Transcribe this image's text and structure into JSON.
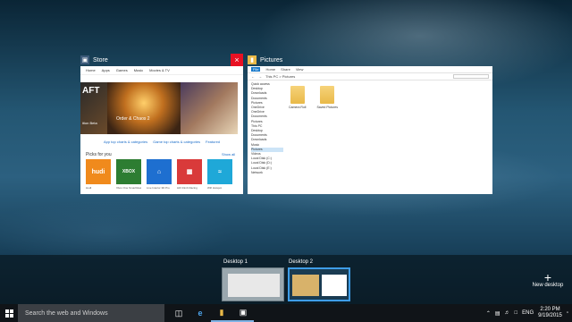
{
  "windows": [
    {
      "title": "Store",
      "nav": [
        "Home",
        "Apps",
        "Games",
        "Music",
        "Movies & TV"
      ],
      "hero_left_title": "AFT",
      "hero_left_sub": "ition Beta",
      "hero_main_title": "Order & Chaos 2",
      "links": [
        "App top charts & categories",
        "Game top charts & categories",
        "Featured"
      ],
      "picks_title": "Picks for you",
      "show_all": "Show all",
      "tiles": [
        {
          "label": "hudi",
          "color": "#f08a1c",
          "caption": "Hudl"
        },
        {
          "label": "XBOX",
          "color": "#2d7d32",
          "caption": "Xbox One SmartGlass"
        },
        {
          "label": "",
          "color": "#1e6fd0",
          "caption": "Live Interior 3D Pro"
        },
        {
          "label": "",
          "color": "#d93a3a",
          "caption": "Hill Climb Racing"
        },
        {
          "label": "",
          "color": "#1fa8d8",
          "caption": "Wifi Hotspot"
        }
      ]
    },
    {
      "title": "Pictures",
      "ribbon": [
        "File",
        "Home",
        "Share",
        "View"
      ],
      "address": "This PC > Pictures",
      "nav_items": [
        "Quick access",
        "Desktop",
        "Downloads",
        "Documents",
        "Pictures",
        "OneDrive",
        "OneDrive",
        "Documents",
        "Pictures",
        "This PC",
        "Desktop",
        "Documents",
        "Downloads",
        "Music",
        "Pictures",
        "Videos",
        "Local Disk (C:)",
        "Local Disk (D:)",
        "Local Disk (E:)",
        "Network"
      ],
      "folders": [
        "Camera Roll",
        "Saved Pictures"
      ]
    }
  ],
  "desktops": [
    {
      "label": "Desktop 1"
    },
    {
      "label": "Desktop 2"
    }
  ],
  "new_desktop_label": "New desktop",
  "taskbar": {
    "search_placeholder": "Search the web and Windows",
    "language": "ENG",
    "time": "2:20 PM",
    "date": "9/19/2015"
  },
  "colors": {
    "accent": "#3e9de8",
    "taskbar": "#101418"
  }
}
